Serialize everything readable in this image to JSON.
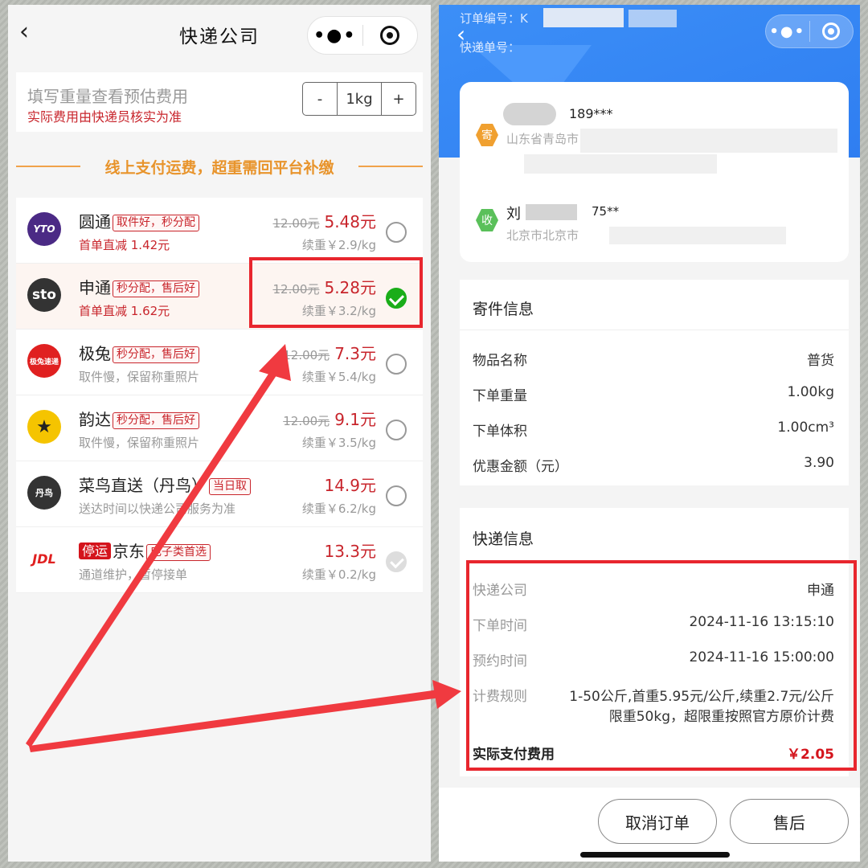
{
  "left": {
    "nav": {
      "back": "‹",
      "title": "快递公司",
      "dots": "•●•"
    },
    "weight": {
      "hint": "填写重量查看预估费用",
      "note": "实际费用由快递员核实为准",
      "minus": "-",
      "value": "1kg",
      "plus": "+"
    },
    "banner": "线上支付运费，超重需回平台补缴",
    "couriers": [
      {
        "name": "圆通",
        "tag": "取件好，秒分配",
        "sub": "首单直减 1.42元",
        "orig": "12.00元",
        "price": "5.48元",
        "cont": "续重￥2.9/kg",
        "logo": "YTO",
        "logo_color": "#4b2a85"
      },
      {
        "name": "申通",
        "tag": "秒分配，售后好",
        "sub": "首单直减 1.62元",
        "orig": "12.00元",
        "price": "5.28元",
        "cont": "续重￥3.2/kg",
        "logo": "sto",
        "logo_color": "#333333"
      },
      {
        "name": "极兔",
        "tag": "秒分配，售后好",
        "sub": "取件慢，保留称重照片",
        "orig": "12.00元",
        "price": "7.3元",
        "cont": "续重￥5.4/kg",
        "logo": "极兔速递",
        "logo_color": "#e02020"
      },
      {
        "name": "韵达",
        "tag": "秒分配，售后好",
        "sub": "取件慢，保留称重照片",
        "orig": "12.00元",
        "price": "9.1元",
        "cont": "续重￥3.5/kg",
        "logo": "★",
        "logo_color": "#f5c400"
      },
      {
        "name": "菜鸟直送（丹鸟）",
        "tag": "当日取",
        "sub": "送达时间以快递公司服务为准",
        "orig": "",
        "price": "14.9元",
        "cont": "续重￥6.2/kg",
        "logo": "丹鸟",
        "logo_color": "#333333"
      },
      {
        "name": "京东",
        "pre_tag": "停运",
        "tag": "电子类首选",
        "sub": "通道维护，暂停接单",
        "orig": "",
        "price": "13.3元",
        "cont": "续重￥0.2/kg",
        "logo": "JDL",
        "logo_color": "#ffffff"
      }
    ]
  },
  "right": {
    "order_no_label": "订单编号：",
    "order_no_value": "K",
    "tracking_label": "快递单号：",
    "back": "‹",
    "dots": "•●•",
    "sender": {
      "badge": "寄",
      "phone": "189*** ",
      "addr": "山东省青岛市"
    },
    "receiver": {
      "badge": "收",
      "name": "刘",
      "phone": "75**",
      "addr": "北京市北京市"
    },
    "send_info": {
      "title": "寄件信息",
      "rows": [
        {
          "k": "物品名称",
          "v": "普货"
        },
        {
          "k": "下单重量",
          "v": "1.00kg"
        },
        {
          "k": "下单体积",
          "v": "1.00cm³"
        },
        {
          "k": "优惠金额（元）",
          "v": "3.90"
        }
      ]
    },
    "courier_info": {
      "title": "快递信息",
      "company_k": "快递公司",
      "company_v": "申通",
      "order_time_k": "下单时间",
      "order_time_v": "2024-11-16 13:15:10",
      "appt_time_k": "预约时间",
      "appt_time_v": "2024-11-16 15:00:00",
      "rule_k": "计费规则",
      "rule_v1": "1-50公斤,首重5.95元/公斤,续重2.7元/公斤",
      "rule_v2": "限重50kg，超限重按照官方原价计费",
      "total_k": "实际支付费用",
      "total_v": "￥2.05"
    },
    "buttons": {
      "cancel": "取消订单",
      "after_sale": "售后"
    }
  },
  "colors": {
    "accent_red": "#e8262e",
    "brand_blue": "#2f7ef1",
    "selected_green": "#1aad19"
  }
}
